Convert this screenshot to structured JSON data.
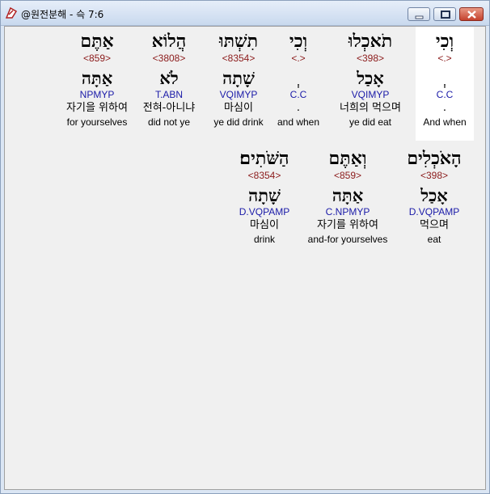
{
  "window": {
    "title": "@원전분해 - 슥 7:6"
  },
  "verse_rows": [
    {
      "words": [
        {
          "hebrew": "וְכִי",
          "strong": "<.>",
          "lemma": "ְ",
          "morph": "C.C",
          "korean": ".",
          "english": "And when",
          "selected": true
        },
        {
          "hebrew": "תֹאכְלוּ",
          "strong": "<398>",
          "lemma": "אָכַל",
          "morph": "VQIMYP",
          "korean": "너희의 먹으며",
          "english": "ye did eat",
          "selected": false
        },
        {
          "hebrew": "וְכִי",
          "strong": "<.>",
          "lemma": "ְ",
          "morph": "C.C",
          "korean": ".",
          "english": "and when",
          "selected": false
        },
        {
          "hebrew": "תִשְׁתּוּ",
          "strong": "<8354>",
          "lemma": "שָׁתָה",
          "morph": "VQIMYP",
          "korean": "마심이",
          "english": "ye did drink",
          "selected": false
        },
        {
          "hebrew": "הֲלוֹא",
          "strong": "<3808>",
          "lemma": "לֹא",
          "morph": "T.ABN",
          "korean": "전혀-아니냐",
          "english": "did not ye",
          "selected": false
        },
        {
          "hebrew": "אַתֶּם",
          "strong": "<859>",
          "lemma": "אַתָּה",
          "morph": "NPMYP",
          "korean": "자기을 위하여",
          "english": "for yourselves",
          "selected": false
        }
      ]
    },
    {
      "words": [
        {
          "hebrew": "הָאֹכְלִים",
          "strong": "<398>",
          "lemma": "אָכַל",
          "morph": "D.VQPAMP",
          "korean": "먹으며",
          "english": "eat",
          "selected": false
        },
        {
          "hebrew": "וְאַתֶּם",
          "strong": "<859>",
          "lemma": "אַתָּה",
          "morph": "C.NPMYP",
          "korean": "자기를 위하여",
          "english": "and-for yourselves",
          "selected": false
        },
        {
          "hebrew": "הַשֹּׁתִים׃",
          "strong": "<8354>",
          "lemma": "שָׁתָה",
          "morph": "D.VQPAMP",
          "korean": "마심이",
          "english": "drink",
          "selected": false
        }
      ]
    }
  ]
}
